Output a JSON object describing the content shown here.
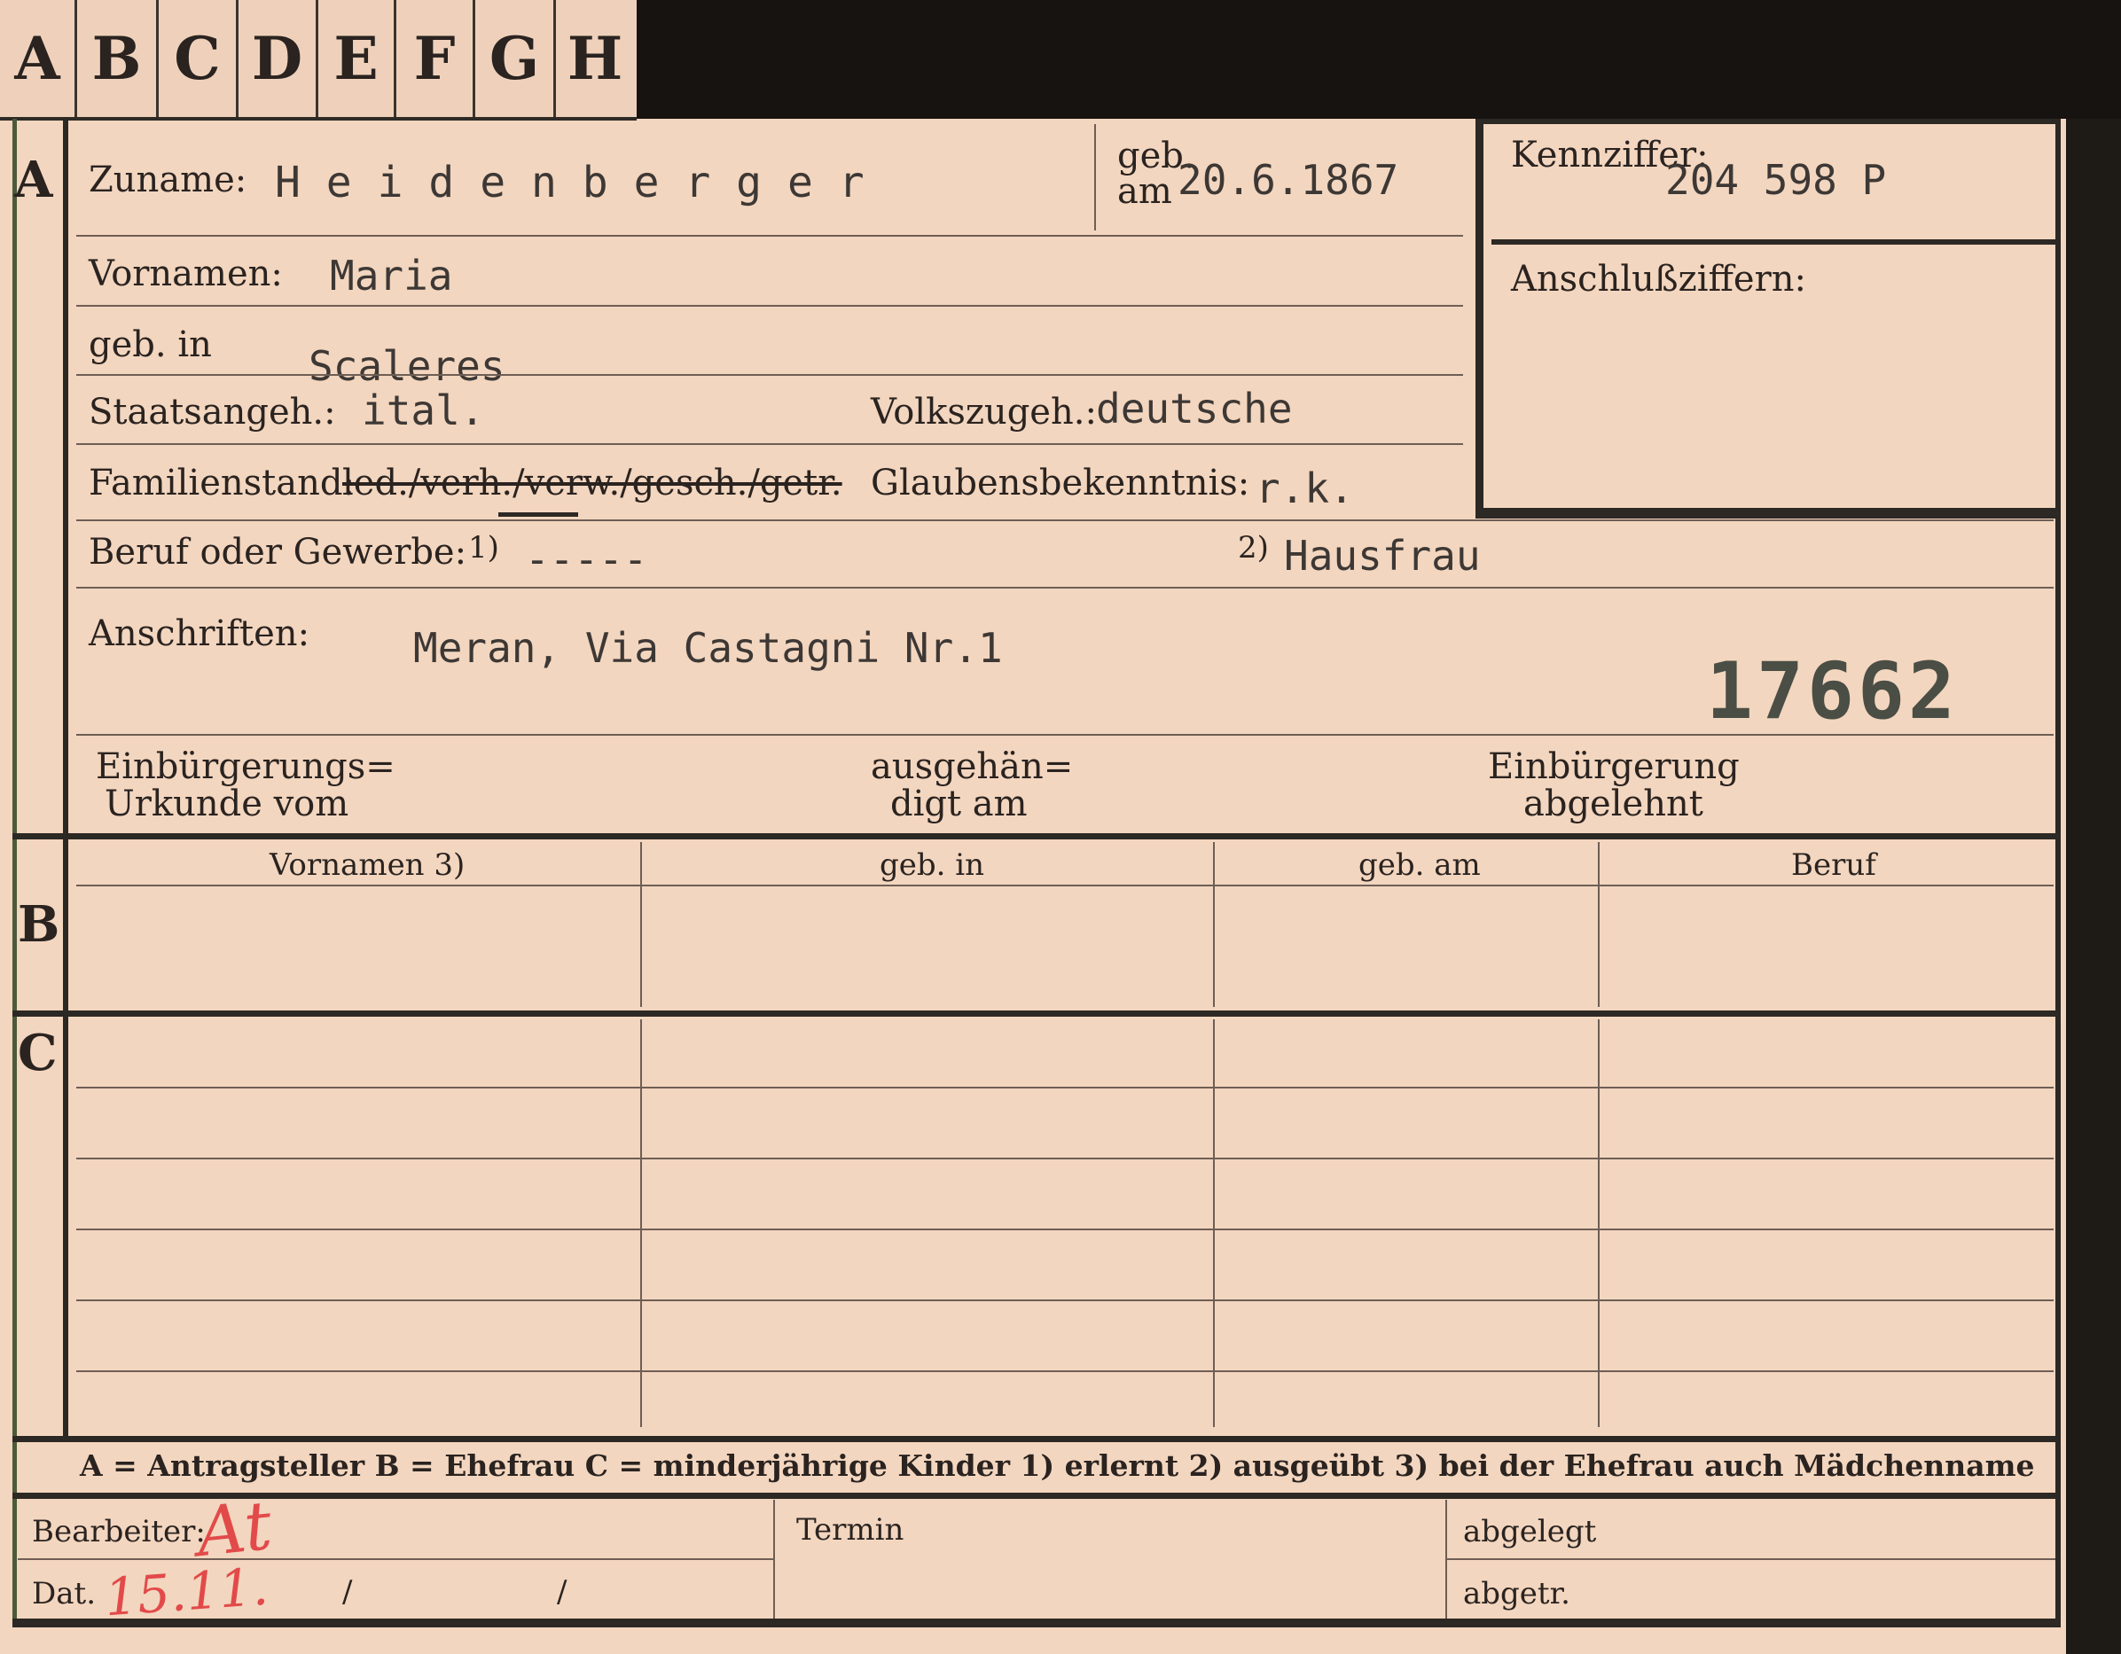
{
  "tabs": [
    "A",
    "B",
    "C",
    "D",
    "E",
    "F",
    "G",
    "H"
  ],
  "sections": {
    "a": "A",
    "b": "B",
    "c": "C"
  },
  "section_a": {
    "zuname_label": "Zuname:",
    "zuname_value": "H e i d e n b e r g e r",
    "geb_am_label_1": "geb.",
    "geb_am_label_2": "am",
    "geb_am_value": "20.6.1867",
    "kennziffer_label": "Kennziffer:",
    "kennziffer_value": "204 598  P",
    "anschluss_label": "Anschlußziffern:",
    "vornamen_label": "Vornamen:",
    "vornamen_value": "Maria",
    "geb_in_label": "geb. in",
    "geb_in_value": "Scaleres",
    "staatsangeh_label": "Staatsangeh.:",
    "staatsangeh_value": "ital.",
    "volkszugeh_label": "Volkszugeh.:",
    "volkszugeh_value": "deutsche",
    "familienstand_label": "Familienstand:",
    "familienstand_options": "led./verh./verw./gesch./getr.",
    "glaubens_label": "Glaubensbekenntnis:",
    "glaubens_value": "r.k.",
    "beruf_label": "Beruf oder Gewerbe:",
    "beruf_marker_1": "1)",
    "beruf_value_1": "-----",
    "beruf_marker_2": "2)",
    "beruf_value_2": "Hausfrau",
    "anschriften_label": "Anschriften:",
    "anschriften_value": "Meran, Via Castagni Nr.1",
    "stamp_number": "17662",
    "einb_urkunde_1": "Einbürgerungs=",
    "einb_urkunde_2": "Urkunde vom",
    "ausgehaendigt_1": "ausgehän=",
    "ausgehaendigt_2": "digt am",
    "einb_abgelehnt_1": "Einbürgerung",
    "einb_abgelehnt_2": "abgelehnt"
  },
  "section_b_headers": [
    "Vornamen 3)",
    "geb. in",
    "geb. am",
    "Beruf"
  ],
  "legend": "A = Antragsteller   B = Ehefrau   C = minderjährige Kinder   1) erlernt   2) ausgeübt   3) bei der Ehefrau auch Mädchenname",
  "footer": {
    "bearbeiter_label": "Bearbeiter:",
    "bearbeiter_initials": "At",
    "dat_label": "Dat.",
    "dat_value": "15.11.",
    "dat_slash_1": "/",
    "dat_slash_2": "/",
    "termin_label": "Termin",
    "abgelegt_label": "abgelegt",
    "abgetr_label": "abgetr."
  }
}
